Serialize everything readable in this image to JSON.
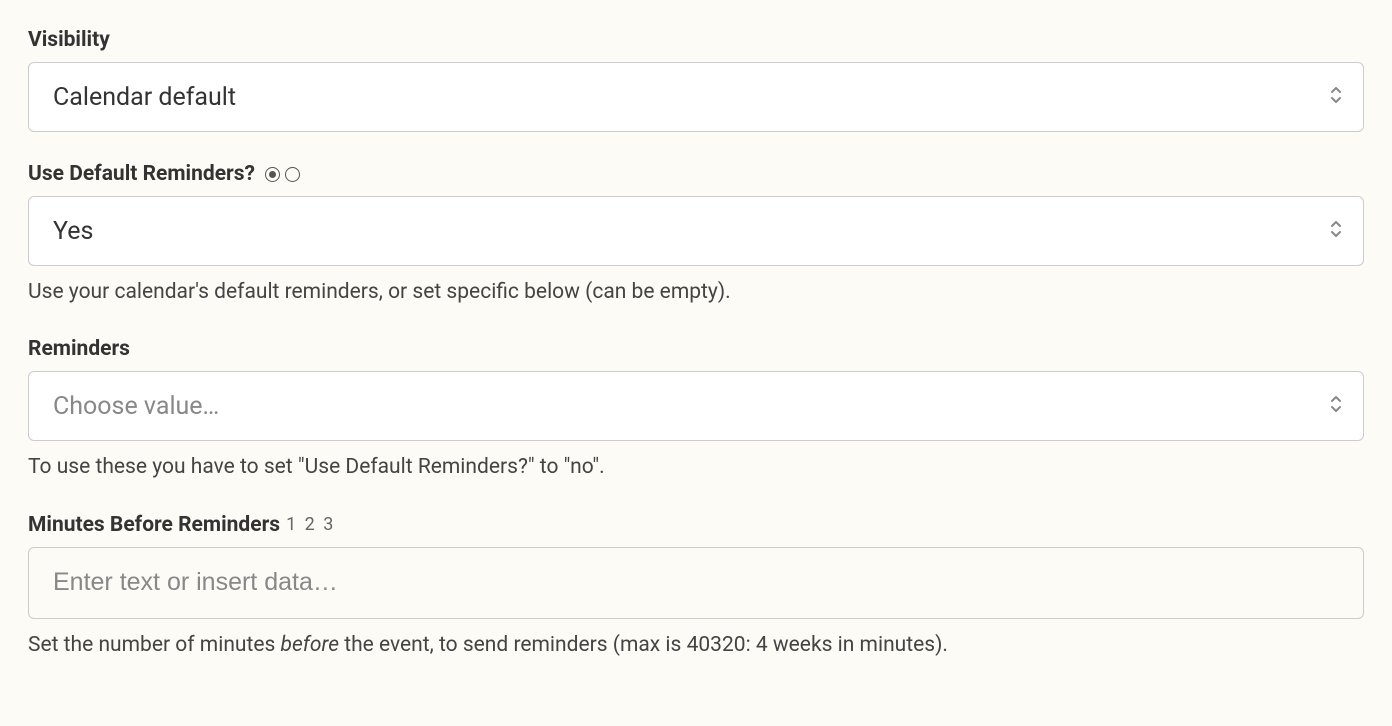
{
  "visibility": {
    "label": "Visibility",
    "value": "Calendar default"
  },
  "use_default_reminders": {
    "label": "Use Default Reminders?",
    "value": "Yes",
    "help": "Use your calendar's default reminders, or set specific below (can be empty)."
  },
  "reminders": {
    "label": "Reminders",
    "placeholder": "Choose value…",
    "help": "To use these you have to set \"Use Default Reminders?\" to \"no\"."
  },
  "minutes_before": {
    "label": "Minutes Before Reminders",
    "badge": "1 2 3",
    "placeholder": "Enter text or insert data…",
    "help_prefix": "Set the number of minutes ",
    "help_em": "before",
    "help_suffix": " the event, to send reminders (max is 40320: 4 weeks in minutes)."
  }
}
